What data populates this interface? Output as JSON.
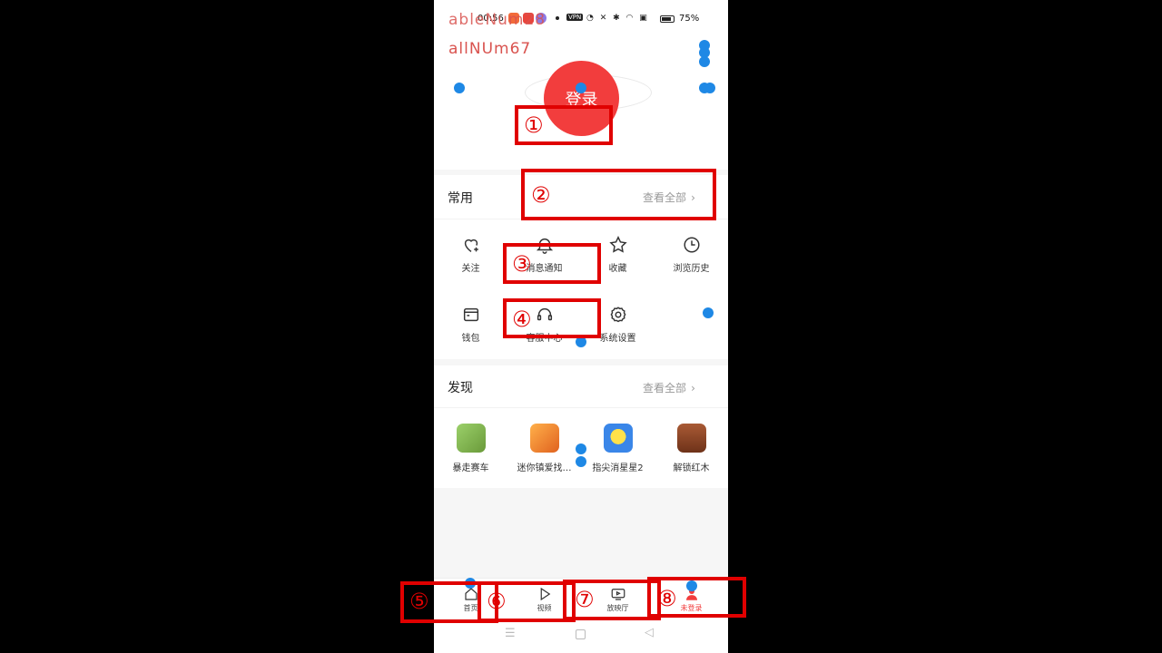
{
  "status_bar": {
    "time": "00:56",
    "battery": "75%",
    "vpn": "VPN"
  },
  "debug_overlay": {
    "line1": "ableNum28",
    "line2": "allNUm67"
  },
  "header": {
    "login_label": "登录"
  },
  "common": {
    "title": "常用",
    "view_all": "查看全部",
    "items": [
      {
        "label": "关注",
        "icon": "heart-plus-icon"
      },
      {
        "label": "消息通知",
        "icon": "bell-icon"
      },
      {
        "label": "收藏",
        "icon": "star-icon"
      },
      {
        "label": "浏览历史",
        "icon": "clock-icon"
      },
      {
        "label": "钱包",
        "icon": "wallet-icon"
      },
      {
        "label": "客服中心",
        "icon": "headset-icon"
      },
      {
        "label": "系统设置",
        "icon": "gear-icon"
      }
    ]
  },
  "discover": {
    "title": "发现",
    "view_all": "查看全部",
    "games": [
      {
        "label": "暴走赛车",
        "color": "#8fbf5a"
      },
      {
        "label": "迷你镇爱找…",
        "color": "#f08a2c"
      },
      {
        "label": "指尖消星星2",
        "color": "#3a86e8"
      },
      {
        "label": "解锁红木",
        "color": "#8b4a2b"
      }
    ]
  },
  "bottom_nav": {
    "items": [
      {
        "label": "首页",
        "icon": "home-icon"
      },
      {
        "label": "视频",
        "icon": "play-icon"
      },
      {
        "label": "放映厅",
        "icon": "tv-icon"
      },
      {
        "label": "未登录",
        "icon": "user-icon"
      }
    ]
  },
  "annotations": [
    "①",
    "②",
    "③",
    "④",
    "⑤",
    "⑥",
    "⑦",
    "⑧"
  ],
  "colors": {
    "accent": "#f23d3d",
    "annotation": "#e00000",
    "marker": "#1e88e5"
  }
}
